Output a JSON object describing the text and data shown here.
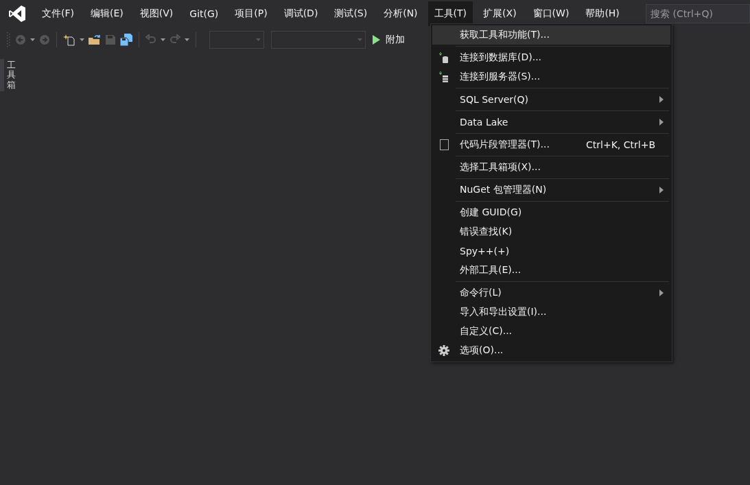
{
  "menu_bar": [
    {
      "label": "文件(F)",
      "selected": false
    },
    {
      "label": "编辑(E)",
      "selected": false
    },
    {
      "label": "视图(V)",
      "selected": false
    },
    {
      "label": "Git(G)",
      "selected": false
    },
    {
      "label": "项目(P)",
      "selected": false
    },
    {
      "label": "调试(D)",
      "selected": false
    },
    {
      "label": "测试(S)",
      "selected": false
    },
    {
      "label": "分析(N)",
      "selected": false
    },
    {
      "label": "工具(T)",
      "selected": true
    },
    {
      "label": "扩展(X)",
      "selected": false
    },
    {
      "label": "窗口(W)",
      "selected": false
    },
    {
      "label": "帮助(H)",
      "selected": false
    }
  ],
  "search": {
    "placeholder": "搜索 (Ctrl+Q)"
  },
  "toolbar": {
    "run_button": {
      "label": "附加"
    }
  },
  "side_tab": {
    "label": "工具箱"
  },
  "tools_menu": {
    "groups": [
      {
        "items": [
          {
            "label": "获取工具和功能(T)...",
            "kind": "plain",
            "highlighted": true,
            "submenu": false
          }
        ]
      },
      {
        "items": [
          {
            "label": "连接到数据库(D)...",
            "kind": "database",
            "highlighted": false,
            "submenu": false
          },
          {
            "label": "连接到服务器(S)...",
            "kind": "server",
            "highlighted": false,
            "submenu": false
          }
        ]
      },
      {
        "items": [
          {
            "label": "SQL Server(Q)",
            "kind": "plain",
            "highlighted": false,
            "submenu": true
          }
        ]
      },
      {
        "items": [
          {
            "label": "Data Lake",
            "kind": "plain",
            "highlighted": false,
            "submenu": true
          }
        ]
      },
      {
        "items": [
          {
            "label": "代码片段管理器(T)...",
            "shortcut": "Ctrl+K, Ctrl+B",
            "kind": "snippet",
            "highlighted": false,
            "submenu": false
          }
        ]
      },
      {
        "items": [
          {
            "label": "选择工具箱项(X)...",
            "kind": "plain",
            "highlighted": false,
            "submenu": false
          }
        ]
      },
      {
        "items": [
          {
            "label": "NuGet 包管理器(N)",
            "kind": "plain",
            "highlighted": false,
            "submenu": true
          }
        ]
      },
      {
        "items": [
          {
            "label": "创建 GUID(G)",
            "kind": "plain",
            "highlighted": false,
            "submenu": false
          },
          {
            "label": "错误查找(K)",
            "kind": "plain",
            "highlighted": false,
            "submenu": false
          },
          {
            "label": "Spy++(+)",
            "kind": "plain",
            "highlighted": false,
            "submenu": false
          },
          {
            "label": "外部工具(E)...",
            "kind": "plain",
            "highlighted": false,
            "submenu": false
          }
        ]
      },
      {
        "items": [
          {
            "label": "命令行(L)",
            "kind": "plain",
            "highlighted": false,
            "submenu": true
          },
          {
            "label": "导入和导出设置(I)...",
            "kind": "plain",
            "highlighted": false,
            "submenu": false
          },
          {
            "label": "自定义(C)...",
            "kind": "plain",
            "highlighted": false,
            "submenu": false
          },
          {
            "label": "选项(O)...",
            "kind": "gear",
            "highlighted": false,
            "submenu": false
          }
        ]
      }
    ]
  }
}
